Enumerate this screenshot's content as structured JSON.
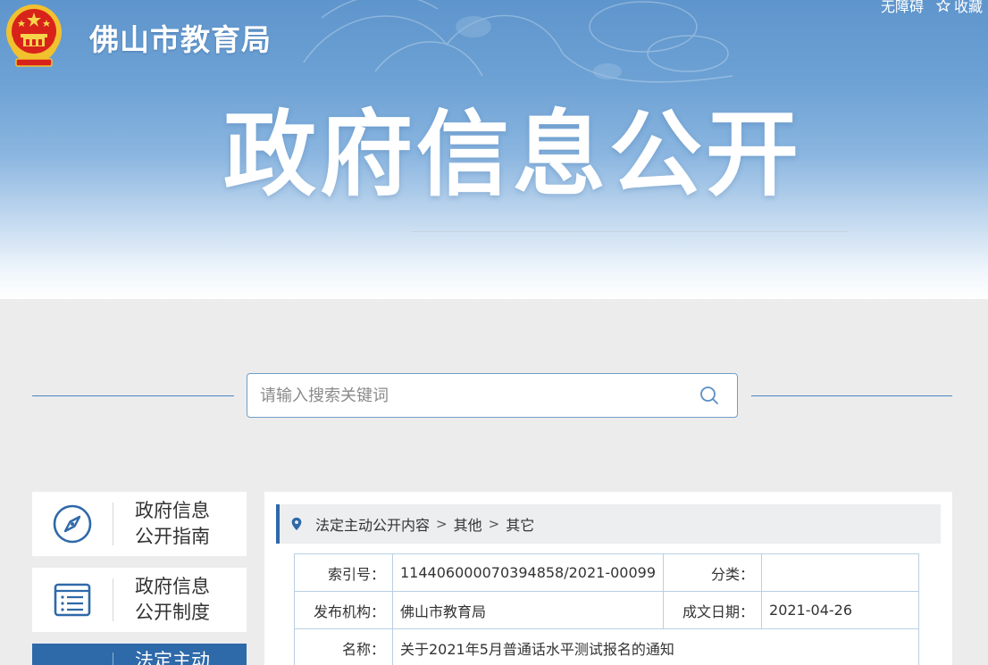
{
  "header": {
    "site_name": "佛山市教育局",
    "hero_title": "政府信息公开",
    "top_links": {
      "accessibility": "无障碍",
      "favorite": "收藏"
    }
  },
  "search": {
    "placeholder": "请输入搜索关键词"
  },
  "sidebar": {
    "items": [
      {
        "line1": "政府信息",
        "line2": "公开指南",
        "icon": "compass-icon",
        "active": false
      },
      {
        "line1": "政府信息",
        "line2": "公开制度",
        "icon": "document-list-icon",
        "active": false
      },
      {
        "line1": "法定主动",
        "line2": "",
        "icon": "folder-icon",
        "active": true
      }
    ]
  },
  "breadcrumb": {
    "items": [
      "法定主动公开内容",
      "其他",
      "其它"
    ],
    "separator": ">"
  },
  "meta": {
    "index_label": "索引号：",
    "index_value": "114406000070394858/2021-00099",
    "category_label": "分类：",
    "category_value": "",
    "publisher_label": "发布机构：",
    "publisher_value": "佛山市教育局",
    "date_label": "成文日期：",
    "date_value": "2021-04-26",
    "name_label": "名称：",
    "name_value": "关于2021年5月普通话水平测试报名的通知"
  },
  "colors": {
    "accent": "#2e69a9",
    "banner_top": "#5e95cc",
    "border": "#b9cfe4"
  }
}
